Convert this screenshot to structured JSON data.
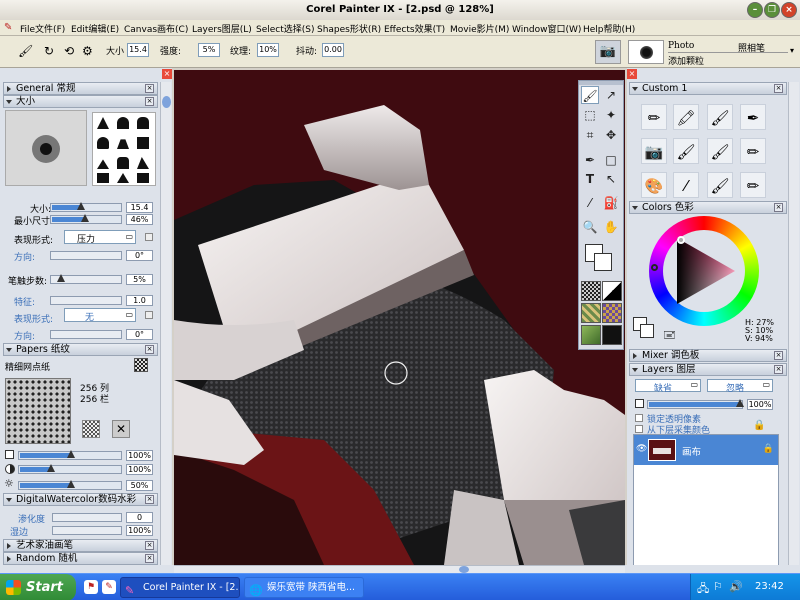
{
  "title": "Corel Painter IX - [2.psd @ 128%]",
  "menu": [
    "File文件(F)",
    "Edit编辑(E)",
    "Canvas画布(C)",
    "Layers图层(L)",
    "Select选择(S)",
    "Shapes形状(R)",
    "Effects效果(T)",
    "Movie影片(M)",
    "Window窗口(W)",
    "Help帮助(H)"
  ],
  "propbar": {
    "size_label": "大小",
    "size_value": "15.4",
    "opacity_label": "强度:",
    "opacity_value": "5%",
    "grain_label": "纹理:",
    "grain_value": "10%",
    "jitter_label": "抖动:",
    "jitter_value": "0.00",
    "brush_category": "Photo",
    "brush_variant": "照相笔",
    "brush_sub": "添加颗粒"
  },
  "left": {
    "general": "General 常规",
    "size_section": "大小",
    "size_label": "大小:",
    "size_value": "15.4",
    "min_size_label": "最小尺寸:",
    "min_size_value": "46%",
    "expression_label": "表现形式:",
    "expression_value": "压力",
    "direction_label": "方向:",
    "direction_value": "0°",
    "step_label": "笔触步数:",
    "step_value": "5%",
    "feature_label": "特征:",
    "feature_value": "1.0",
    "expression2_label": "表现形式:",
    "expression2_value": "无",
    "direction2_label": "方向:",
    "direction2_value": "0°",
    "papers": "Papers 纸纹",
    "paper_name": "精细网点纸",
    "cols": "256 列",
    "rows": "256 栏",
    "scale_value": "100%",
    "contrast_value": "100%",
    "brightness_value": "50%",
    "digital_wc": "DigitalWatercolor数码水彩",
    "wet_label": "渗化度",
    "wet_value": "0",
    "wet_edge_label": "湿边",
    "wet_edge_value": "100%",
    "artist_oils": "艺术家油画笔",
    "random": "Random 随机"
  },
  "right": {
    "custom": "Custom 1",
    "colors": "Colors 色彩",
    "hsv": {
      "h": "H: 27%",
      "s": "S: 10%",
      "v": "V: 94%"
    },
    "mixer": "Mixer 调色板",
    "layers": "Layers 图层",
    "composite_method": "缺省",
    "composite_depth": "忽略",
    "opacity": "100%",
    "pick_up": "锁定透明像素",
    "pick_up2": "从下层采集颜色",
    "layer_name": "画布"
  },
  "taskbar": {
    "start": "Start",
    "tasks": [
      "Corel Painter IX - [2.p...",
      "娱乐宽带 陕西省电..."
    ],
    "clock": "23:42"
  },
  "colors": {
    "canvas_bg": "#3f0b10",
    "accent": "#4a86d4",
    "taskbar": "#245ddb",
    "start": "#3a9a3f",
    "layer_sel": "#4a86d4"
  }
}
